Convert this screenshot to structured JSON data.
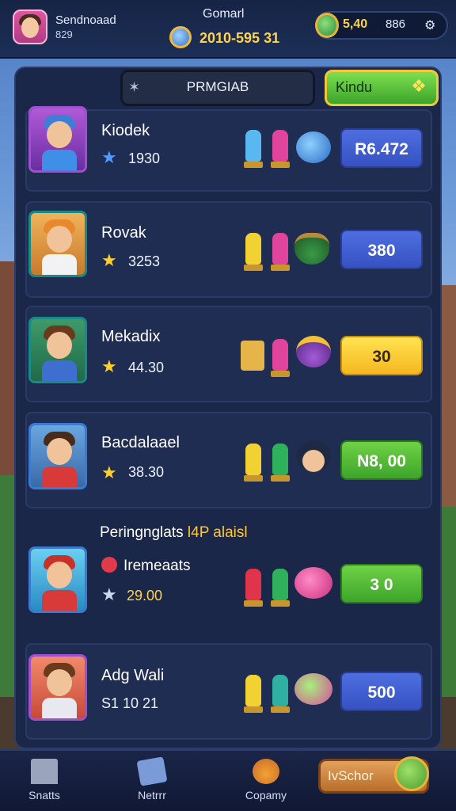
{
  "header": {
    "player_name": "Sendnoaad",
    "player_level": "829",
    "center_label": "Gomarl",
    "coin_value": "2010-595 31",
    "res_a": "5,40",
    "res_b": "886",
    "settings_icon": "⚙"
  },
  "tabs": {
    "main_label": "PRMGIAB",
    "main_icon": "✶",
    "kind_label": "Kindu",
    "kind_icon": "❖"
  },
  "rows": [
    {
      "name": "Kiodek",
      "score": "1930",
      "price": "R6.472",
      "price_style": "blue",
      "star_color": "#4f9cff"
    },
    {
      "name": "Rovak",
      "score": "3253",
      "price": "380",
      "price_style": "blue",
      "star_color": "#ffcf2e"
    },
    {
      "name": "Mekadix",
      "score": "44.30",
      "price": "30",
      "price_style": "yellow",
      "star_color": "#ffcf2e"
    },
    {
      "name": "Bacdalaael",
      "score": "38.30",
      "price": "N8, 00",
      "price_style": "green",
      "star_color": "#ffcf2e"
    },
    {
      "name": "Iremeaats",
      "score": "29.00",
      "price": "3 0",
      "price_style": "green",
      "star_color": "#cfd7ea"
    },
    {
      "name": "Adg Wali",
      "score": "S1 10 21",
      "price": "500",
      "price_style": "blue",
      "star_color": ""
    }
  ],
  "promo": {
    "title": "Peringnglats",
    "tag": "l4P alaisl"
  },
  "nav": {
    "item1": "Snatts",
    "item2": "Netrrr",
    "item3": "Copamy",
    "shop": "IvSchor"
  },
  "colors": {
    "accent_yellow": "#ffd34a",
    "panel": "#1b2748",
    "row": "#202d52"
  }
}
